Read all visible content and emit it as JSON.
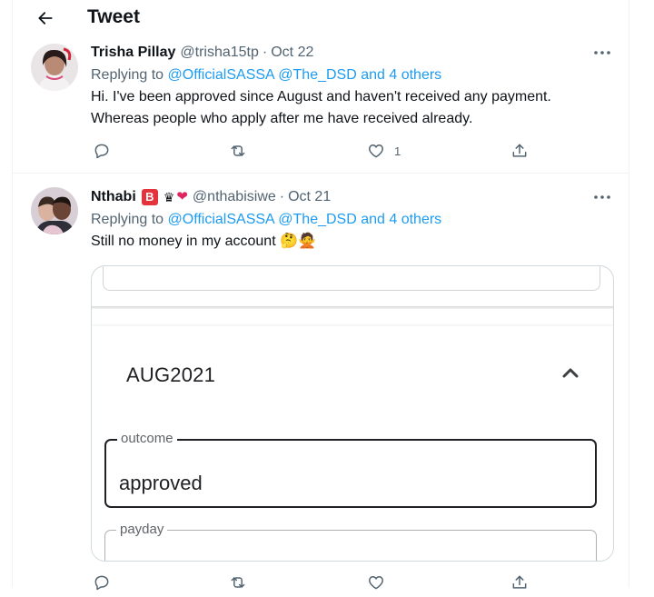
{
  "header": {
    "title": "Tweet",
    "back_icon": "arrow-left-icon"
  },
  "tweets": [
    {
      "name": "Trisha Pillay",
      "handle": "@trisha15tp",
      "separator": "·",
      "date": "Oct 22",
      "replying_prefix": "Replying to",
      "replying_mentions": "@OfficialSASSA @The_DSD and 4 others",
      "text": "Hi. I've been approved since August and haven't received any payment. Whereas people who apply after me have received already.",
      "like_count": "1"
    },
    {
      "name": "Nthabi",
      "badge": "B",
      "emoji_crown": "♛",
      "emoji_heart": "❤",
      "handle": "@nthabisiwe",
      "separator": "·",
      "date": "Oct 21",
      "replying_prefix": "Replying to",
      "replying_mentions": "@OfficialSASSA @The_DSD and 4 others",
      "text": "Still no money in my account 🤔🙅",
      "media": {
        "month": "AUG2021",
        "outcome_label": "outcome",
        "outcome_value": "approved",
        "payday_label": "payday"
      }
    }
  ],
  "colors": {
    "link": "#1d9bf0",
    "muted": "#536471",
    "text": "#0f1419",
    "badge": "#e5333b",
    "heart": "#e0245e"
  }
}
